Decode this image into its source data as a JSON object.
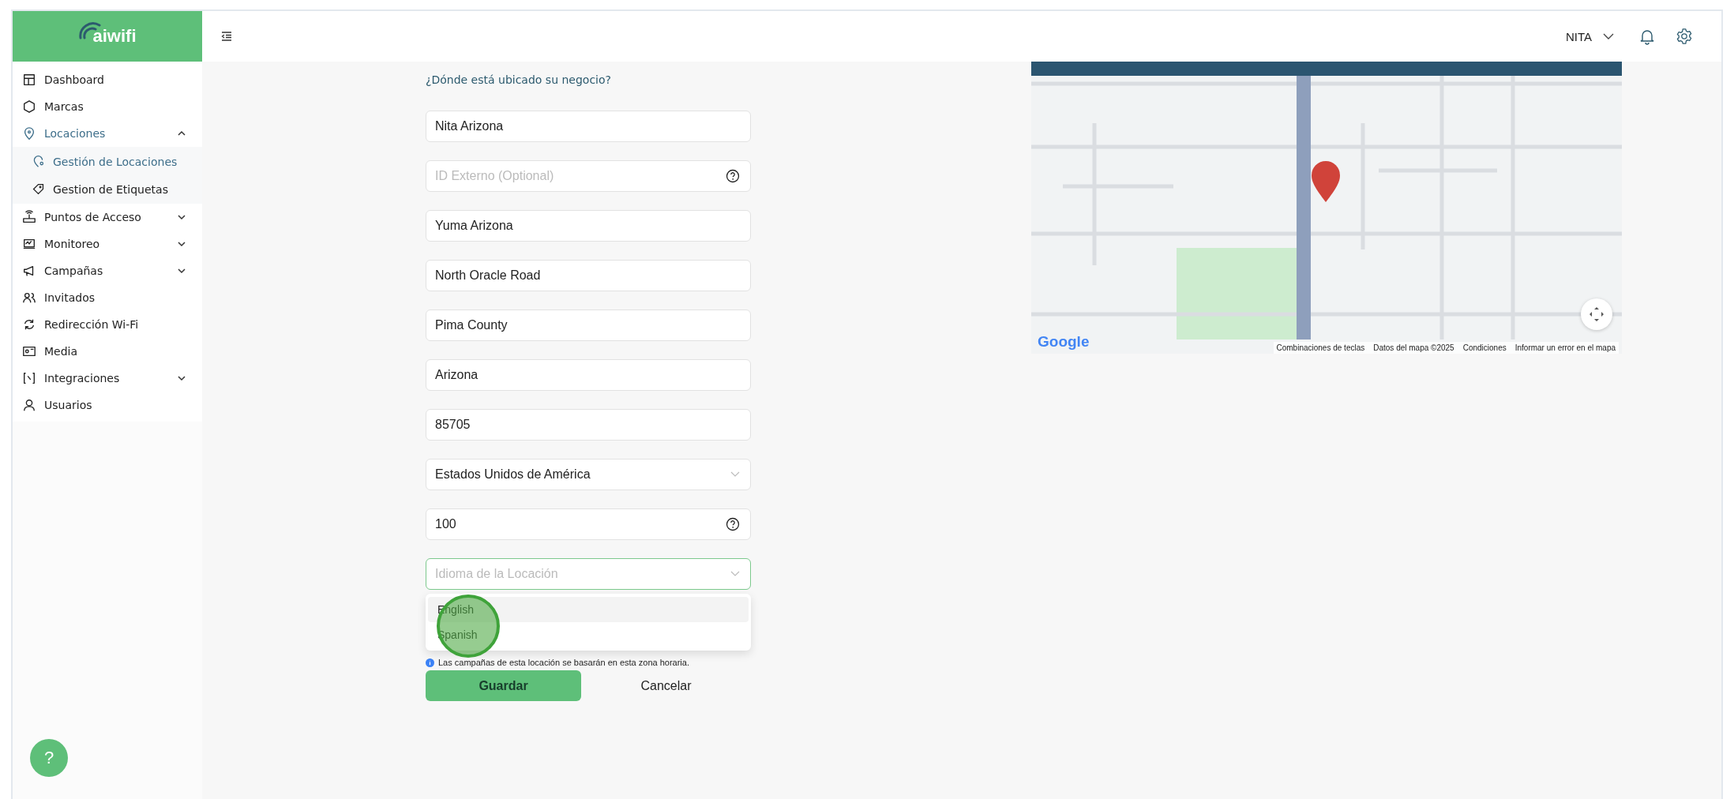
{
  "sidebar": {
    "logo": "aiwifi",
    "items": [
      {
        "label": "Dashboard",
        "selected": false
      },
      {
        "label": "Marcas",
        "selected": false
      },
      {
        "label": "Locaciones",
        "selected": true,
        "expanded": true,
        "children": [
          {
            "label": "Gestión de Locaciones",
            "selected": true
          },
          {
            "label": "Gestion de Etiquetas",
            "selected": false
          }
        ]
      },
      {
        "label": "Puntos de Acceso",
        "selected": false,
        "expanded": false
      },
      {
        "label": "Monitoreo",
        "selected": false,
        "expanded": false
      },
      {
        "label": "Campañas",
        "selected": false,
        "expanded": false
      },
      {
        "label": "Invitados",
        "selected": false
      },
      {
        "label": "Redirección Wi-Fi",
        "selected": false
      },
      {
        "label": "Media",
        "selected": false
      },
      {
        "label": "Integraciones",
        "selected": false,
        "expanded": false
      },
      {
        "label": "Usuarios",
        "selected": false
      }
    ]
  },
  "header": {
    "user": "NITA"
  },
  "form": {
    "question": "¿Dónde está ubicado su negocio?",
    "fields": [
      {
        "kind": "text",
        "value": "Nita Arizona",
        "focused": false
      },
      {
        "kind": "text-help",
        "placeholder": "ID Externo (Optional)",
        "focused": false
      },
      {
        "kind": "text",
        "value": "Yuma Arizona",
        "focused": false
      },
      {
        "kind": "text",
        "value": "North Oracle Road",
        "focused": false
      },
      {
        "kind": "text",
        "value": "Pima County",
        "focused": false
      },
      {
        "kind": "text",
        "value": "Arizona",
        "focused": false
      },
      {
        "kind": "text",
        "value": "85705",
        "focused": false
      },
      {
        "kind": "select",
        "value": "Estados Unidos de América",
        "focused": false
      },
      {
        "kind": "text-help",
        "value": "100",
        "focused": false
      },
      {
        "kind": "select",
        "placeholder": "Idioma de la Locación",
        "focused": true,
        "options": [
          {
            "label": "English",
            "selected": true
          },
          {
            "label": "Spanish",
            "selected": false
          }
        ]
      }
    ],
    "note": "Las campañas de esta locación se basarán en esta zona horaria.",
    "save": "Guardar",
    "cancel": "Cancelar"
  },
  "map": {
    "logo": "Google",
    "links": [
      "Combinaciones de teclas",
      "Datos del mapa ©2025",
      "Condiciones",
      "Informar un error en el mapa"
    ]
  },
  "help_button": "?"
}
